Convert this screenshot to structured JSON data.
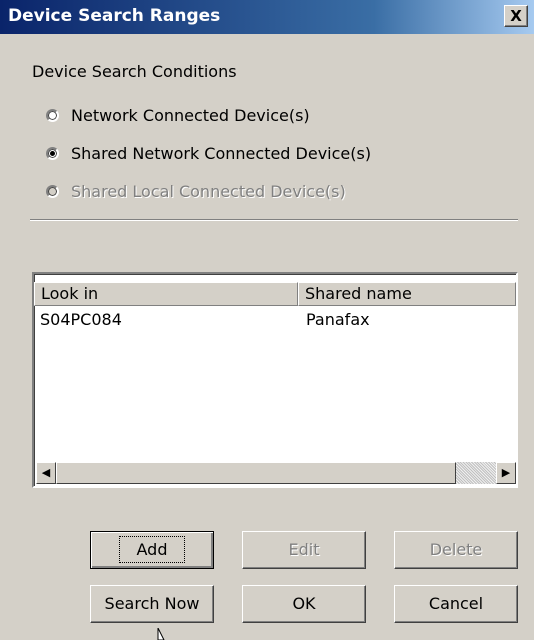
{
  "window": {
    "title": "Device Search Ranges",
    "close_label": "X"
  },
  "conditions": {
    "label": "Device Search Conditions",
    "options": [
      {
        "label": "Network Connected Device(s)",
        "checked": false,
        "enabled": true
      },
      {
        "label": "Shared Network Connected Device(s)",
        "checked": true,
        "enabled": true
      },
      {
        "label": "Shared Local Connected Device(s)",
        "checked": false,
        "enabled": false
      }
    ]
  },
  "list": {
    "columns": [
      "Look in",
      "Shared name"
    ],
    "rows": [
      [
        "S04PC084",
        "Panafax"
      ]
    ]
  },
  "buttons": {
    "add": "Add",
    "edit": "Edit",
    "delete": "Delete",
    "search_now": "Search Now",
    "ok": "OK",
    "cancel": "Cancel"
  }
}
